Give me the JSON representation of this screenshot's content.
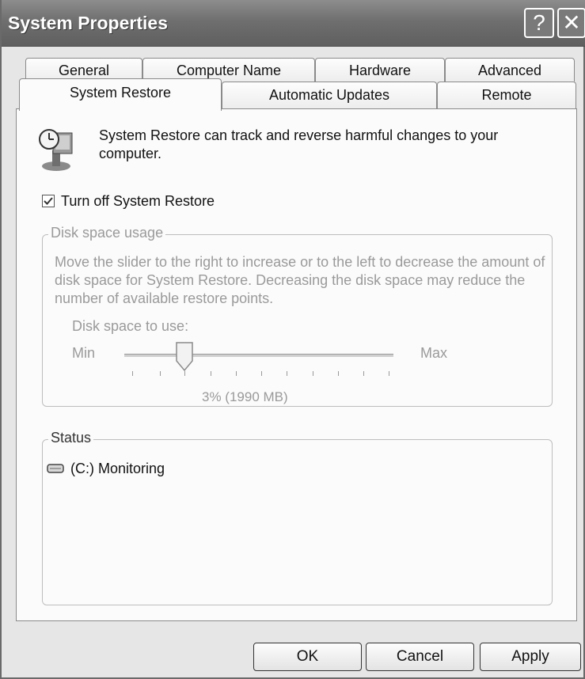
{
  "window": {
    "title": "System Properties",
    "help_label": "?",
    "close_label": "✕"
  },
  "tabs": {
    "row1": [
      "General",
      "Computer Name",
      "Hardware",
      "Advanced"
    ],
    "row2": [
      "System Restore",
      "Automatic Updates",
      "Remote"
    ],
    "active": "System Restore"
  },
  "intro": {
    "icon": "system-restore-icon",
    "text": "System Restore can track and reverse harmful changes to your computer."
  },
  "turn_off": {
    "label": "Turn off System Restore",
    "checked": true
  },
  "disk_space": {
    "legend": "Disk space usage",
    "description": "Move the slider to the right to increase or to the left to decrease the amount of disk space for System Restore. Decreasing the disk space may reduce the number of available restore points.",
    "slider_label": "Disk space to use:",
    "min_label": "Min",
    "max_label": "Max",
    "value_text": "3% (1990 MB)",
    "level_percent": 3
  },
  "status": {
    "legend": "Status",
    "drive_icon": "drive-icon",
    "drive_text": "(C:) Monitoring"
  },
  "buttons": {
    "ok": "OK",
    "cancel": "Cancel",
    "apply": "Apply"
  }
}
